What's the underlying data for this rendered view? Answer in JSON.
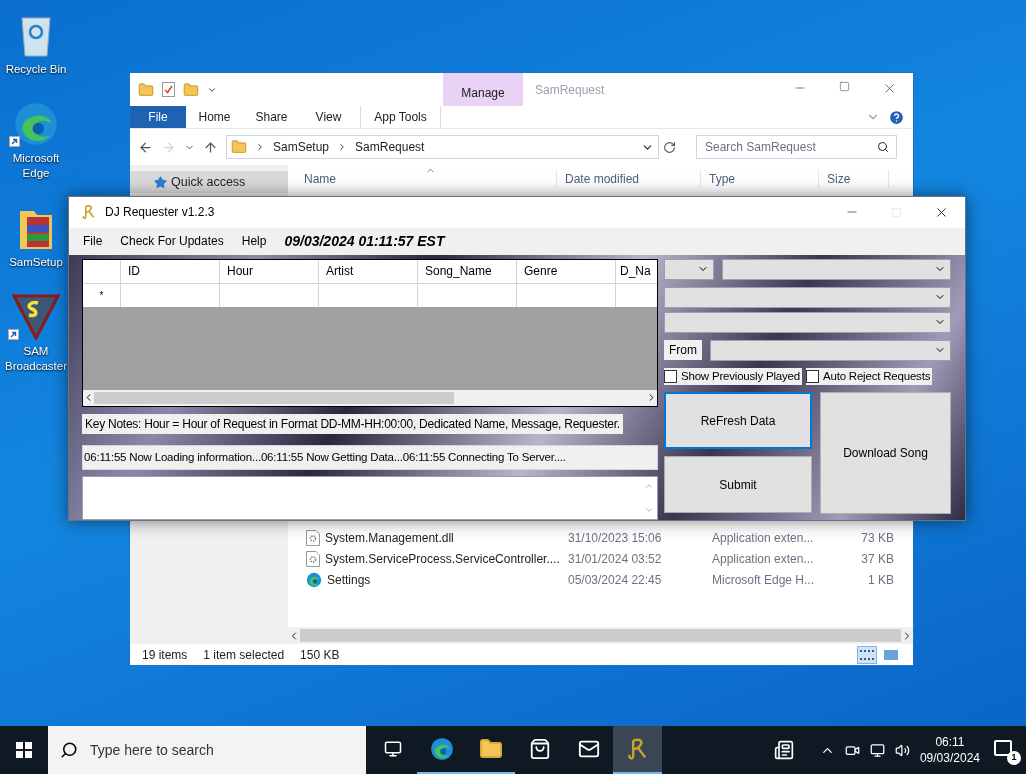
{
  "desktop_icons": [
    {
      "kind": "recycle",
      "label": "Recycle Bin",
      "shortcut": false
    },
    {
      "kind": "edge",
      "label": "Microsoft Edge",
      "shortcut": true
    },
    {
      "kind": "archive",
      "label": "SamSetup",
      "shortcut": false
    },
    {
      "kind": "sam",
      "label": "SAM Broadcaster",
      "shortcut": true
    }
  ],
  "explorer": {
    "title": "SamRequest",
    "context_tab": "Manage",
    "ribbon_tabs": [
      {
        "kind": "file",
        "label": "File"
      },
      {
        "kind": "plain",
        "label": "Home"
      },
      {
        "kind": "plain",
        "label": "Share"
      },
      {
        "kind": "plain",
        "label": "View"
      },
      {
        "kind": "context",
        "label": "App Tools"
      }
    ],
    "breadcrumb": [
      "SamSetup",
      "SamRequest"
    ],
    "search": {
      "placeholder": "Search SamRequest"
    },
    "nav_items": [
      {
        "label": "Quick access",
        "selected": true
      }
    ],
    "columns": [
      "Name",
      "Date modified",
      "Type",
      "Size"
    ],
    "files": [
      {
        "kind": "dll",
        "name": "System.Management.dll",
        "date": "31/10/2023 15:06",
        "type": "Application exten...",
        "size": "73 KB"
      },
      {
        "kind": "dll",
        "name": "System.ServiceProcess.ServiceController....",
        "date": "31/01/2024 03:52",
        "type": "Application exten...",
        "size": "37 KB"
      },
      {
        "kind": "edge",
        "name": "Settings",
        "date": "05/03/2024 22:45",
        "type": "Microsoft Edge H...",
        "size": "1 KB"
      }
    ],
    "status": [
      "19 items",
      "1 item selected",
      "150 KB"
    ],
    "view_buttons": [
      {
        "kind": "details",
        "selected": true
      },
      {
        "kind": "tiles",
        "selected": false
      }
    ]
  },
  "dj": {
    "title": "DJ Requester v1.2.3",
    "menu": [
      "File",
      "Check For Updates",
      "Help"
    ],
    "clock": "09/03/2024 01:11:57 EST",
    "grid": {
      "columns": [
        "ID",
        "Hour",
        "Artist",
        "Song_Name",
        "Genre",
        "D_Na"
      ],
      "new_row_marker": "*"
    },
    "key_notes": "Key Notes: Hour = Hour of Request in Format DD-MM-HH:00:00, Dedicated Name, Message, Requester.",
    "log": "06:11:55 Now Loading information...06:11:55 Now Getting Data...06:11:55 Connecting To Server....",
    "from_label": "From",
    "checkboxes": [
      {
        "label": "Show Previously Played",
        "checked": false
      },
      {
        "label": "Auto Reject Requests",
        "checked": false
      }
    ],
    "buttons": [
      {
        "kind": "refresh",
        "label": "ReFresh Data",
        "focused": true
      },
      {
        "kind": "submit",
        "label": "Submit",
        "focused": false
      },
      {
        "kind": "download",
        "label": "Download Song",
        "focused": false
      }
    ]
  },
  "taskbar": {
    "search": {
      "placeholder": "Type here to search"
    },
    "apps": [
      {
        "kind": "taskview",
        "running": false,
        "active": false
      },
      {
        "kind": "edge",
        "running": true,
        "active": false
      },
      {
        "kind": "folder",
        "running": true,
        "active": false
      },
      {
        "kind": "store",
        "running": false,
        "active": false
      },
      {
        "kind": "mail",
        "running": false,
        "active": false
      },
      {
        "kind": "dj",
        "running": true,
        "active": true
      }
    ],
    "time": "06:11",
    "date": "09/03/2024",
    "notification_count": "1"
  }
}
